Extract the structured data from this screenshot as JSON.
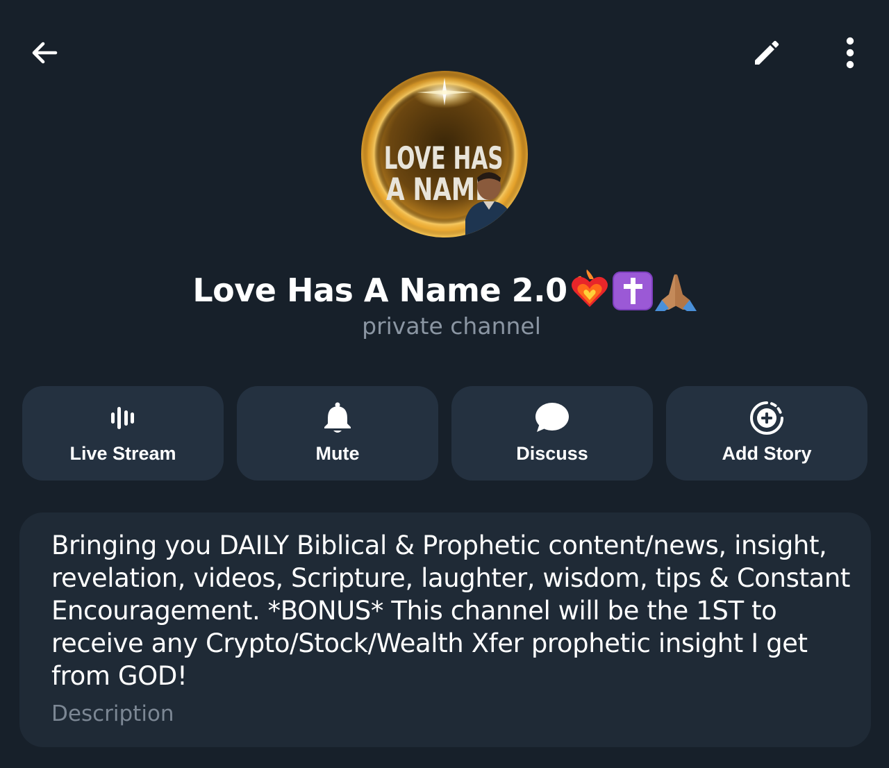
{
  "header": {
    "back_icon": "arrow-left-icon",
    "edit_icon": "pencil-icon",
    "more_icon": "more-vertical-icon"
  },
  "avatar": {
    "text_line1": "LOVE HAS",
    "text_line2": "A NAME"
  },
  "channel": {
    "name": "Love Has A Name 2.0",
    "name_emojis": [
      "heart-on-fire-emoji",
      "latin-cross-emoji",
      "praying-hands-emoji"
    ],
    "subtitle": "private channel"
  },
  "actions": [
    {
      "label": "Live Stream",
      "icon": "live-stream-icon"
    },
    {
      "label": "Mute",
      "icon": "bell-icon"
    },
    {
      "label": "Discuss",
      "icon": "chat-bubble-icon"
    },
    {
      "label": "Add Story",
      "icon": "add-story-icon"
    }
  ],
  "description": {
    "text": "Bringing you DAILY Biblical & Prophetic content/news, insight, revelation, videos, Scripture, laughter, wisdom, tips & Constant Encouragement. *BONUS* This channel will be the 1ST to receive any Crypto/Stock/Wealth Xfer prophetic insight I get from GOD!",
    "label": "Description"
  },
  "colors": {
    "background": "#17202a",
    "button_bg": "#243140",
    "card_bg": "#1f2a36",
    "muted_text": "#8b96a3"
  }
}
